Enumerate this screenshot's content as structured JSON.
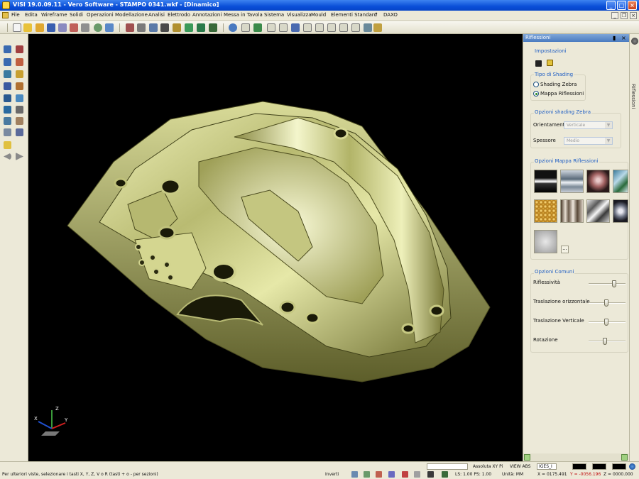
{
  "window": {
    "title": "VISI 19.0.09.11 - Vero Software - STAMPO 0341.wkf - [Dinamico]",
    "min": "_",
    "max": "□",
    "close": "×"
  },
  "menu": {
    "items": [
      "File",
      "Edita",
      "Wireframe",
      "Solidi",
      "Operazioni",
      "Modellazione",
      "Analisi",
      "Elettrodo",
      "Annotazioni",
      "Messa in Tavola",
      "Sistema",
      "Visualizza",
      "Mould",
      "Elementi Standard",
      "?",
      "DAXO"
    ]
  },
  "panel": {
    "title": "Riflessioni",
    "side_tab": "Riflessioni",
    "impostazioni": "Impostazioni",
    "tipo_shading": {
      "label": "Tipo di Shading",
      "options": [
        "Shading Zebra",
        "Mappa Riflessioni"
      ],
      "selected": 1
    },
    "opzioni_zebra": {
      "label": "Opzioni shading Zebra",
      "orientamento_label": "Orientamento",
      "orientamento_value": "Verticale",
      "spessore_label": "Spessore",
      "spessore_value": "Medio"
    },
    "mappa": {
      "label": "Opzioni Mappa Riflessioni",
      "more_button": "..."
    },
    "comuni": {
      "label": "Opzioni Comuni",
      "sliders": [
        {
          "label": "Riflessività",
          "value": 0.75
        },
        {
          "label": "Traslazione orizzontale",
          "value": 0.5
        },
        {
          "label": "Traslazione Verticale",
          "value": 0.5
        },
        {
          "label": "Rotazione",
          "value": 0.45
        }
      ]
    }
  },
  "axis": {
    "x": "X",
    "y": "Y",
    "z": "Z"
  },
  "status": {
    "hint": "Per ulteriori viste, selezionare i tasti X, Y, Z, V o R (tasti + o - per sezioni)",
    "assoluta": "Assoluta XY Pi",
    "view": "VIEW ABS",
    "layer": "IGES_I",
    "inverti": "Inverti",
    "ls_ps": "LS: 1.00 PS: 1.00",
    "unita": "Unità: MM",
    "x": "X = 0175.491",
    "y": "Y = -0056.196",
    "z": "Z = 0000.000"
  },
  "colors": {
    "accent": "#0a4fd8",
    "viewport": "#000000",
    "model": "#c9c98a",
    "group_label": "#1f5ec4"
  }
}
